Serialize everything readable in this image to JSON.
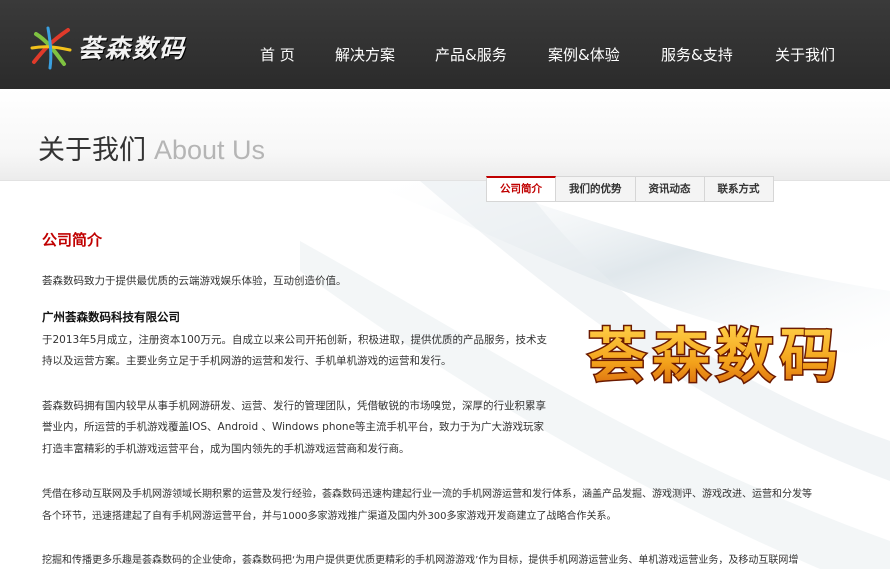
{
  "header": {
    "logo_text": "荟森数码",
    "nav": [
      {
        "label": "首 页"
      },
      {
        "label": "解决方案"
      },
      {
        "label": "产品&服务"
      },
      {
        "label": "案例&体验"
      },
      {
        "label": "服务&支持"
      },
      {
        "label": "关于我们"
      }
    ]
  },
  "page": {
    "title_cn": "关于我们",
    "title_en": "About Us"
  },
  "tabs": [
    {
      "label": "公司简介",
      "active": true
    },
    {
      "label": "我们的优势",
      "active": false
    },
    {
      "label": "资讯动态",
      "active": false
    },
    {
      "label": "联系方式",
      "active": false
    }
  ],
  "content": {
    "heading": "公司简介",
    "intro": "荟森数码致力于提供最优质的云端游戏娱乐体验，互动创造价值。",
    "company_name": "广州荟森数码科技有限公司",
    "p1_line1": "于2013年5月成立，注册资本100万元。自成立以来公司开拓创新，积极进取，提供优质的产品服务，技术支",
    "p1_line2": "持以及运营方案。主要业务立足于手机网游的运营和发行、手机单机游戏的运营和发行。",
    "p2_line1": "荟森数码拥有国内较早从事手机网游研发、运营、发行的管理团队，凭借敏锐的市场嗅觉，深厚的行业积累享",
    "p2_line2": "誉业内，所运营的手机游戏覆盖IOS、Android 、Windows phone等主流手机平台，致力于为广大游戏玩家",
    "p2_line3": "打造丰富精彩的手机游戏运营平台，成为国内领先的手机游戏运营商和发行商。",
    "p3_line1": "凭借在移动互联网及手机网游领域长期积累的运营及发行经验，荟森数码迅速构建起行业一流的手机网游运营和发行体系，涵盖产品发掘、游戏测评、游戏改进、运营和分发等",
    "p3_line2": "各个环节，迅速搭建起了自有手机网游运营平台，并与1000多家游戏推广渠道及国内外300多家游戏开发商建立了战略合作关系。",
    "p4_line1": "挖掘和传播更多乐趣是荟森数码的企业使命，荟森数码把‘为用户提供更优质更精彩的手机网游游戏’作为目标，提供手机网游运营业务、单机游戏运营业务，及移动互联网增",
    "brand_art_text": "荟森数码"
  },
  "colors": {
    "header_bg": "#2f2f2f",
    "accent": "#c00000",
    "brand_art_fill": "#f3a21b",
    "brand_art_outline": "#7a1d00"
  }
}
